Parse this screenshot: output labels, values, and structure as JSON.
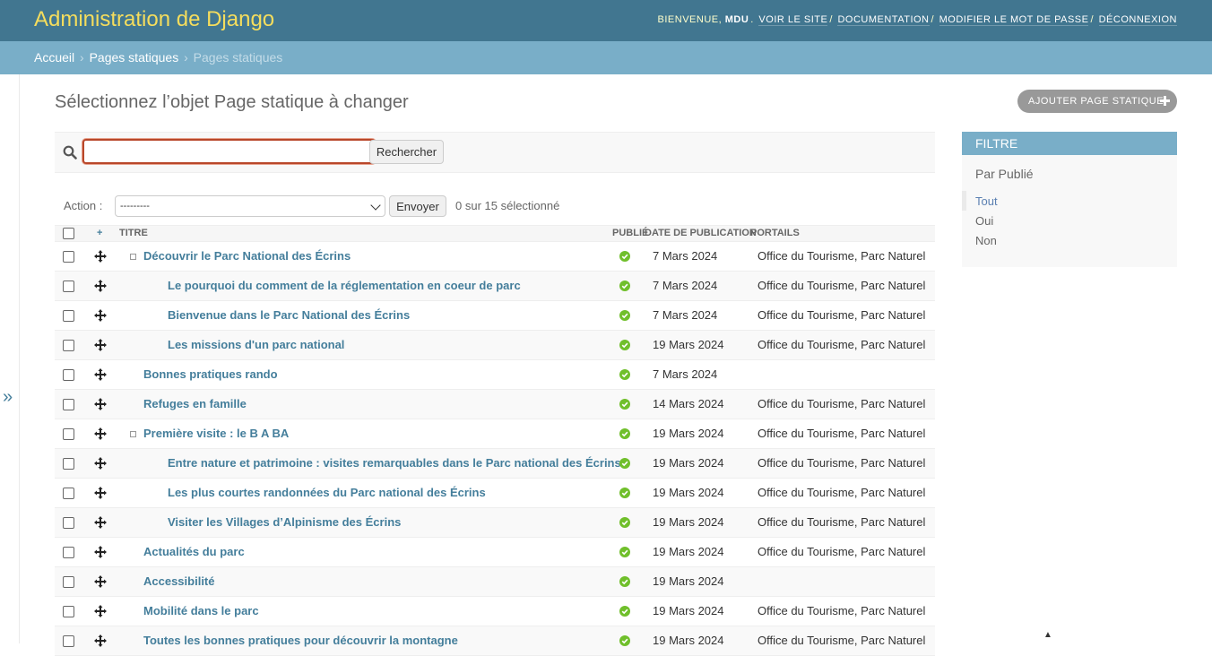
{
  "header": {
    "branding": "Administration de Django",
    "welcome": "Bienvenue,",
    "username": "mdu",
    "links": {
      "view_site": "Voir le site",
      "documentation": "Documentation",
      "change_password": "Modifier le mot de passe",
      "logout": "Déconnexion"
    }
  },
  "breadcrumbs": {
    "home": "Accueil",
    "app": "Pages statiques",
    "current": "Pages statiques"
  },
  "sidebar_toggle": "»",
  "page": {
    "title": "Sélectionnez l’objet Page statique à changer",
    "add_button": "Ajouter page statique"
  },
  "search": {
    "value": "",
    "button": "Rechercher"
  },
  "actions": {
    "label": "Action :",
    "selected": "---------",
    "go": "Envoyer",
    "counter": "0 sur 15 sélectionné"
  },
  "table": {
    "columns": {
      "move": "+",
      "title": "Titre",
      "published": "Publié",
      "pub_date": "Date de publication",
      "portals": "Portails"
    },
    "rows": [
      {
        "title": "Découvrir le Parc National des Écrins",
        "level": 0,
        "has_children": true,
        "published": true,
        "date": "7 Mars 2024",
        "portals": "Office du Tourisme, Parc Naturel"
      },
      {
        "title": "Le pourquoi du comment de la réglementation en coeur de parc",
        "level": 1,
        "has_children": false,
        "published": true,
        "date": "7 Mars 2024",
        "portals": "Office du Tourisme, Parc Naturel"
      },
      {
        "title": "Bienvenue dans le Parc National des Écrins",
        "level": 1,
        "has_children": false,
        "published": true,
        "date": "7 Mars 2024",
        "portals": "Office du Tourisme, Parc Naturel"
      },
      {
        "title": "Les missions d'un parc national",
        "level": 1,
        "has_children": false,
        "published": true,
        "date": "19 Mars 2024",
        "portals": "Office du Tourisme, Parc Naturel"
      },
      {
        "title": "Bonnes pratiques rando",
        "level": 0,
        "has_children": false,
        "published": true,
        "date": "7 Mars 2024",
        "portals": ""
      },
      {
        "title": "Refuges en famille",
        "level": 0,
        "has_children": false,
        "published": true,
        "date": "14 Mars 2024",
        "portals": "Office du Tourisme, Parc Naturel"
      },
      {
        "title": "Première visite : le B A BA",
        "level": 0,
        "has_children": true,
        "published": true,
        "date": "19 Mars 2024",
        "portals": "Office du Tourisme, Parc Naturel"
      },
      {
        "title": "Entre nature et patrimoine : visites remarquables dans le Parc national des Écrins",
        "level": 1,
        "has_children": false,
        "published": true,
        "date": "19 Mars 2024",
        "portals": "Office du Tourisme, Parc Naturel"
      },
      {
        "title": "Les plus courtes randonnées du Parc national des Écrins",
        "level": 1,
        "has_children": false,
        "published": true,
        "date": "19 Mars 2024",
        "portals": "Office du Tourisme, Parc Naturel"
      },
      {
        "title": "Visiter les Villages d’Alpinisme des Écrins",
        "level": 1,
        "has_children": false,
        "published": true,
        "date": "19 Mars 2024",
        "portals": "Office du Tourisme, Parc Naturel"
      },
      {
        "title": "Actualités du parc",
        "level": 0,
        "has_children": false,
        "published": true,
        "date": "19 Mars 2024",
        "portals": "Office du Tourisme, Parc Naturel"
      },
      {
        "title": "Accessibilité",
        "level": 0,
        "has_children": false,
        "published": true,
        "date": "19 Mars 2024",
        "portals": ""
      },
      {
        "title": "Mobilité dans le parc",
        "level": 0,
        "has_children": false,
        "published": true,
        "date": "19 Mars 2024",
        "portals": "Office du Tourisme, Parc Naturel"
      },
      {
        "title": "Toutes les bonnes pratiques pour découvrir la montagne",
        "level": 0,
        "has_children": false,
        "published": true,
        "date": "19 Mars 2024",
        "portals": "Office du Tourisme, Parc Naturel"
      }
    ]
  },
  "filter": {
    "title": "Filtre",
    "heading": "Par Publié",
    "choices": [
      {
        "label": "Tout",
        "selected": true
      },
      {
        "label": "Oui",
        "selected": false
      },
      {
        "label": "Non",
        "selected": false
      }
    ]
  },
  "colors": {
    "header_bg": "#417690",
    "breadcrumb_bg": "#79aec8",
    "link": "#447e9b",
    "published_icon": "#70bf2b",
    "search_focus_border": "#b8472a"
  },
  "icons": {
    "search": "search-icon",
    "move": "move-arrows-icon",
    "published": "check-circle-icon",
    "add": "plus-icon"
  }
}
